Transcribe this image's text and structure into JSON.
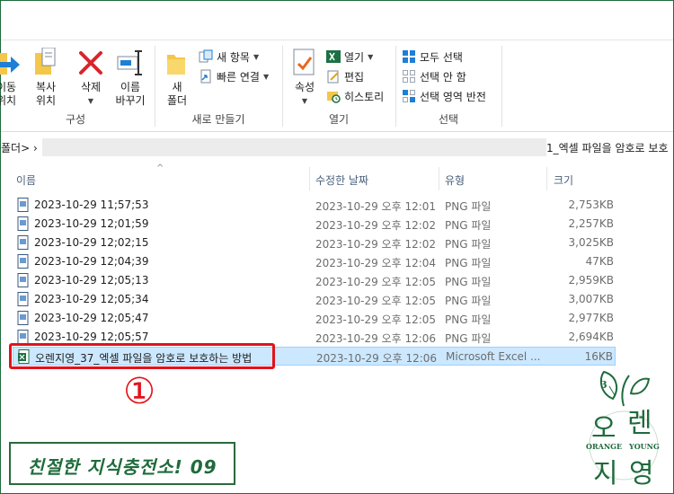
{
  "ribbon": {
    "organize": {
      "label": "구성",
      "move_line1": "이동",
      "move_line2": "위치",
      "copy_line1": "복사",
      "copy_line2": "위치",
      "delete": "삭제",
      "rename_line1": "이름",
      "rename_line2": "바꾸기"
    },
    "new": {
      "label": "새로 만들기",
      "new_folder_line1": "새",
      "new_folder_line2": "폴더",
      "new_item": "새 항목",
      "easy_access": "빠른 연결"
    },
    "open": {
      "label": "열기",
      "properties": "속성",
      "open": "열기",
      "edit": "편집",
      "history": "히스토리"
    },
    "select": {
      "label": "선택",
      "select_all": "모두 선택",
      "select_none": "선택 안 함",
      "invert": "선택 영역 반전"
    }
  },
  "address": {
    "left": "폴더>  ›",
    "right": "1_엑셀 파일을 암호로 보호"
  },
  "columns": {
    "name": "이름",
    "date": "수정한 날짜",
    "type": "유형",
    "size": "크기"
  },
  "files": [
    {
      "name": "2023-10-29 11;57;53",
      "date": "2023-10-29 오후 12:01",
      "type": "PNG 파일",
      "size": "2,753KB"
    },
    {
      "name": "2023-10-29 12;01;59",
      "date": "2023-10-29 오후 12:02",
      "type": "PNG 파일",
      "size": "2,257KB"
    },
    {
      "name": "2023-10-29 12;02;15",
      "date": "2023-10-29 오후 12:02",
      "type": "PNG 파일",
      "size": "3,025KB"
    },
    {
      "name": "2023-10-29 12;04;39",
      "date": "2023-10-29 오후 12:04",
      "type": "PNG 파일",
      "size": "47KB"
    },
    {
      "name": "2023-10-29 12;05;13",
      "date": "2023-10-29 오후 12:05",
      "type": "PNG 파일",
      "size": "2,959KB"
    },
    {
      "name": "2023-10-29 12;05;34",
      "date": "2023-10-29 오후 12:05",
      "type": "PNG 파일",
      "size": "3,007KB"
    },
    {
      "name": "2023-10-29 12;05;47",
      "date": "2023-10-29 오후 12:05",
      "type": "PNG 파일",
      "size": "2,977KB"
    },
    {
      "name": "2023-10-29 12;05;57",
      "date": "2023-10-29 오후 12:06",
      "type": "PNG 파일",
      "size": "2,694KB"
    },
    {
      "name": "오렌지영_37_엑셀 파일을 암호로 보호하는 방법",
      "date": "2023-10-29 오후 12:06",
      "type": "Microsoft Excel ...",
      "size": "16KB"
    }
  ],
  "annotation": {
    "marker": "①",
    "banner": "친절한 지식충전소! 09"
  },
  "logo": {
    "ch1": "오",
    "ch2": "렌",
    "ch3": "지",
    "ch4": "영",
    "en_left": "ORANGE",
    "en_right": "YOUNG",
    "number": "3"
  },
  "colors": {
    "accent_green": "#1f6b3c",
    "highlight_red": "#e3121b",
    "selection": "#cce8ff"
  }
}
